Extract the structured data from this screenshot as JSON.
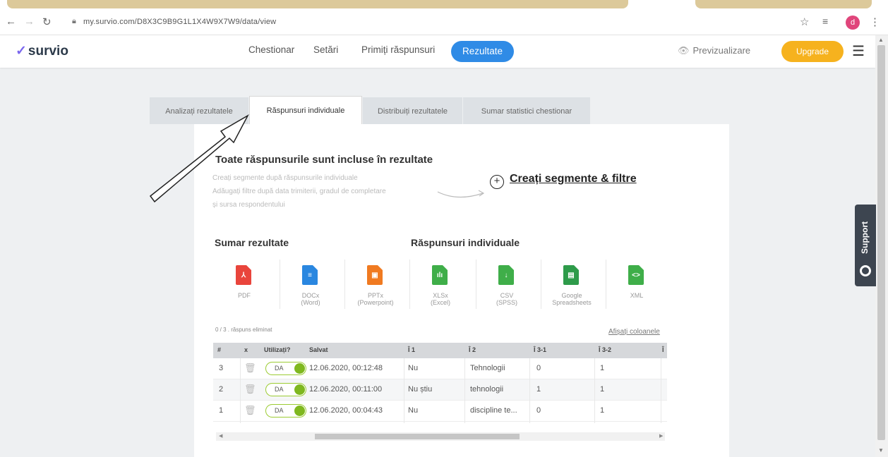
{
  "browser": {
    "url": "my.survio.com/D8X3C9B9G1L1X4W9X7W9/data/view",
    "profile_initial": "d"
  },
  "header": {
    "logo": "survio",
    "nav": [
      "Chestionar",
      "Setări",
      "Primiți răspunsuri"
    ],
    "active_nav": "Rezultate",
    "preview": "Previzualizare",
    "upgrade": "Upgrade"
  },
  "tabs": [
    {
      "label": "Analizați rezultatele"
    },
    {
      "label": "Răspunsuri individuale"
    },
    {
      "label": "Distribuiți rezultatele"
    },
    {
      "label": "Sumar statistici chestionar"
    }
  ],
  "segments": {
    "title": "Toate răspunsurile sunt incluse în rezultate",
    "desc_line1": "Creați segmente după răspunsurile individuale",
    "desc_line2": "Adăugați filtre după data trimiterii, gradul de completare",
    "desc_line3": "și sursa respondentului",
    "link": "Creați segmente & filtre"
  },
  "exports_headers": {
    "summary": "Sumar rezultate",
    "individual": "Răspunsuri individuale"
  },
  "exports": [
    {
      "name": "PDF",
      "sub": "",
      "color": "#e9453c",
      "glyph": "⅄"
    },
    {
      "name": "DOCx",
      "sub": "(Word)",
      "color": "#2a87e0",
      "glyph": "≡"
    },
    {
      "name": "PPTx",
      "sub": "(Powerpoint)",
      "color": "#f07a21",
      "glyph": "▣"
    },
    {
      "name": "XLSx",
      "sub": "(Excel)",
      "color": "#3fae49",
      "glyph": "ılı"
    },
    {
      "name": "CSV",
      "sub": "(SPSS)",
      "color": "#3fae49",
      "glyph": "↓"
    },
    {
      "name": "Google",
      "sub": "Spreadsheets",
      "color": "#2e9b4a",
      "glyph": "▤"
    },
    {
      "name": "XML",
      "sub": "",
      "color": "#3fae49",
      "glyph": "<>"
    }
  ],
  "table_meta": {
    "selection": "0 / 3 . răspuns eliminat",
    "show_columns": "Afișați coloanele"
  },
  "table": {
    "headers": [
      "#",
      "x",
      "Utilizați?",
      "Salvat",
      "Î 1",
      "Î 2",
      "Î 3-1",
      "Î 3-2",
      "Î"
    ],
    "rows": [
      {
        "n": "3",
        "toggle": "DA",
        "saved": "12.06.2020, 00:12:48",
        "q1": "Nu",
        "q2": "Tehnologii",
        "q31": "0",
        "q32": "1"
      },
      {
        "n": "2",
        "toggle": "DA",
        "saved": "12.06.2020, 00:11:00",
        "q1": "Nu știu",
        "q2": "tehnologii",
        "q31": "1",
        "q32": "1"
      },
      {
        "n": "1",
        "toggle": "DA",
        "saved": "12.06.2020, 00:04:43",
        "q1": "Nu",
        "q2": "discipline te...",
        "q31": "0",
        "q32": "1"
      }
    ]
  },
  "support": "Support"
}
